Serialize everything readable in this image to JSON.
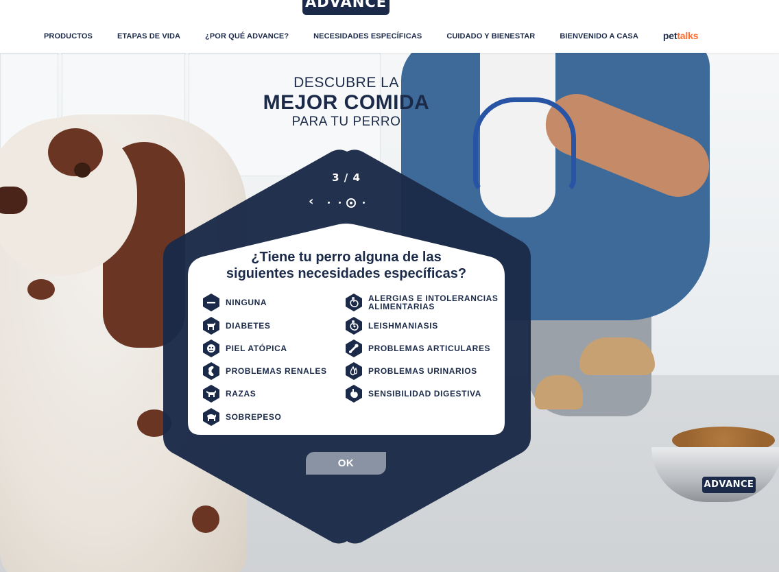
{
  "brand": {
    "logo_text": "ADVANCE"
  },
  "nav": {
    "items": [
      "PRODUCTOS",
      "ETAPAS DE VIDA",
      "¿POR QUÉ ADVANCE?",
      "NECESIDADES ESPECÍFICAS",
      "CUIDADO Y BIENESTAR",
      "BIENVENIDO A CASA"
    ],
    "pettalks_pet": "pet",
    "pettalks_talks": "talks"
  },
  "hero": {
    "line1": "DESCUBRE LA",
    "line2": "MEJOR COMIDA",
    "line3": "PARA TU PERRO"
  },
  "quiz": {
    "step": "3 / 4",
    "question_line1": "¿Tiene tu perro alguna de las",
    "question_line2": "siguientes necesidades específicas?",
    "options_left": [
      {
        "label": "NINGUNA",
        "icon": "minus-icon"
      },
      {
        "label": "DIABETES",
        "icon": "dog-diabetes-icon"
      },
      {
        "label": "PIEL ATÓPICA",
        "icon": "atopic-skin-icon"
      },
      {
        "label": "PROBLEMAS RENALES",
        "icon": "kidney-icon"
      },
      {
        "label": "RAZAS",
        "icon": "dog-breed-icon"
      },
      {
        "label": "SOBREPESO",
        "icon": "overweight-icon"
      }
    ],
    "options_right": [
      {
        "label_line1": "ALERGIAS E INTOLERANCIAS",
        "label_line2": "ALIMENTARIAS",
        "icon": "stomach-allergy-icon"
      },
      {
        "label": "LEISHMANIASIS",
        "icon": "leishmaniasis-icon"
      },
      {
        "label": "PROBLEMAS ARTICULARES",
        "icon": "joint-icon"
      },
      {
        "label": "PROBLEMAS URINARIOS",
        "icon": "urinary-icon"
      },
      {
        "label": "SENSIBILIDAD DIGESTIVA",
        "icon": "digestive-icon"
      }
    ],
    "ok_label": "OK"
  },
  "bowl_label": "ADVANCE",
  "colors": {
    "navy": "#1b2a48",
    "orange": "#ff6b2b",
    "button_gray": "#8a93a3",
    "white": "#ffffff"
  }
}
